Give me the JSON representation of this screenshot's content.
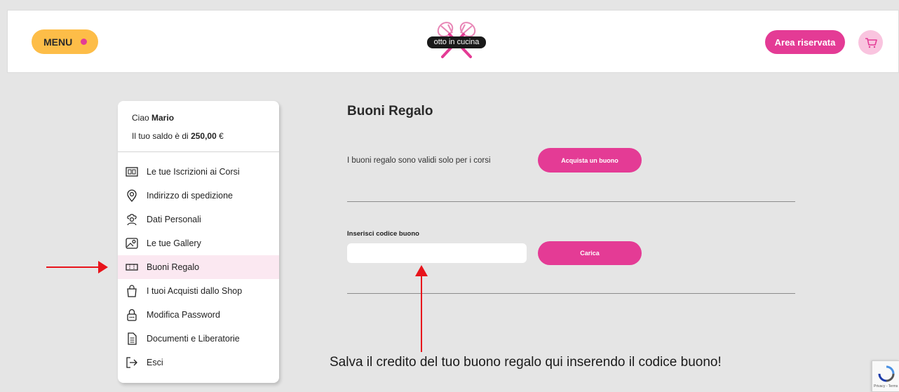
{
  "header": {
    "menu_label": "MENU",
    "logo_text": "otto in cucina",
    "area_label": "Area riservata",
    "cart_icon": "cart-icon"
  },
  "sidebar": {
    "greeting_prefix": "Ciao ",
    "user_name": "Mario",
    "balance_prefix": "Il tuo saldo è di ",
    "balance_value": "250,00",
    "balance_suffix": " €",
    "items": [
      {
        "label": "Le tue Iscrizioni ai Corsi",
        "icon": "courses-icon"
      },
      {
        "label": "Indirizzo di spedizione",
        "icon": "location-pin-icon"
      },
      {
        "label": "Dati Personali",
        "icon": "chef-icon"
      },
      {
        "label": "Le tue Gallery",
        "icon": "gallery-icon"
      },
      {
        "label": "Buoni Regalo",
        "icon": "voucher-icon"
      },
      {
        "label": "I tuoi Acquisti dallo Shop",
        "icon": "shopping-bag-icon"
      },
      {
        "label": "Modifica Password",
        "icon": "lock-icon"
      },
      {
        "label": "Documenti e Liberatorie",
        "icon": "document-icon"
      },
      {
        "label": "Esci",
        "icon": "logout-icon"
      }
    ],
    "active_index": 4
  },
  "main": {
    "title": "Buoni Regalo",
    "info_text": "I buoni regalo sono validi solo per i corsi",
    "buy_label": "Acquista un buono",
    "code_label": "Inserisci codice buono",
    "code_value": "",
    "code_placeholder": "",
    "load_label": "Carica"
  },
  "annotation": {
    "text": "Salva il credito del tuo buono regalo qui inserendo il codice buono!"
  },
  "recaptcha": {
    "text": "Privacy - Terms"
  },
  "colors": {
    "accent_pink": "#e43b95",
    "menu_yellow": "#fdbd48",
    "annotation_red": "#e8141b"
  }
}
